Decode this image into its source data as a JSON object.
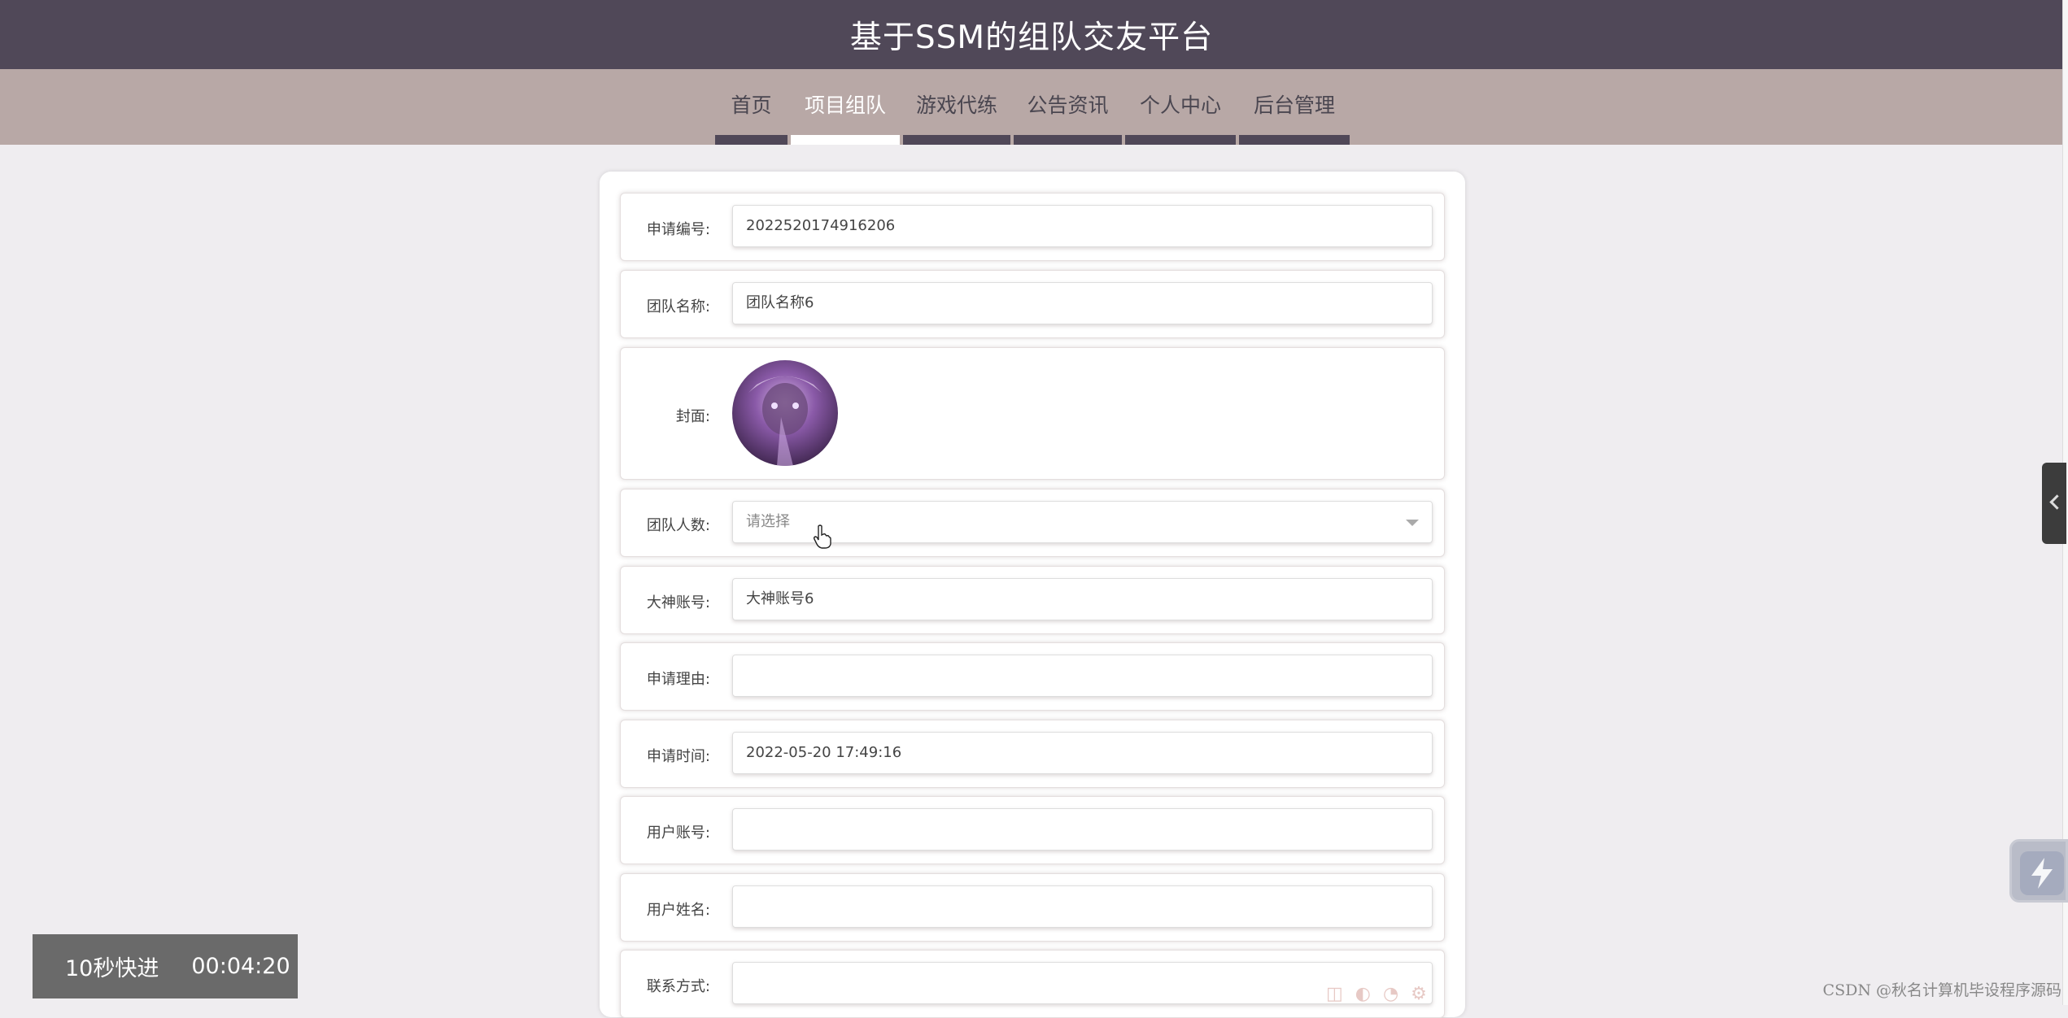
{
  "header": {
    "title": "基于SSM的组队交友平台"
  },
  "nav": {
    "items": [
      {
        "label": "首页"
      },
      {
        "label": "项目组队"
      },
      {
        "label": "游戏代练"
      },
      {
        "label": "公告资讯"
      },
      {
        "label": "个人中心"
      },
      {
        "label": "后台管理"
      }
    ],
    "active_index": 1
  },
  "form": {
    "apply_no": {
      "label": "申请编号:",
      "value": "2022520174916206"
    },
    "team_name": {
      "label": "团队名称:",
      "value": "团队名称6"
    },
    "cover": {
      "label": "封面:"
    },
    "team_size": {
      "label": "团队人数:",
      "placeholder": "请选择"
    },
    "master_account": {
      "label": "大神账号:",
      "value": "大神账号6"
    },
    "reason": {
      "label": "申请理由:",
      "value": ""
    },
    "apply_time": {
      "label": "申请时间:",
      "value": "2022-05-20 17:49:16"
    },
    "user_account": {
      "label": "用户账号:",
      "value": ""
    },
    "user_name": {
      "label": "用户姓名:",
      "value": ""
    },
    "contact": {
      "label": "联系方式:",
      "value": ""
    }
  },
  "overlay": {
    "label": "10秒快进",
    "time": "00:04:20"
  },
  "watermark": "CSDN @秋名计算机毕设程序源码",
  "icons": {
    "side_tab": "chevron-left-icon",
    "float_button": "lightning-icon",
    "cursor": "hand-pointer-icon",
    "select_caret": "caret-down-icon"
  },
  "colors": {
    "header_bg": "#504858",
    "nav_bg": "#b8a8a6",
    "page_bg": "#efedf0"
  }
}
